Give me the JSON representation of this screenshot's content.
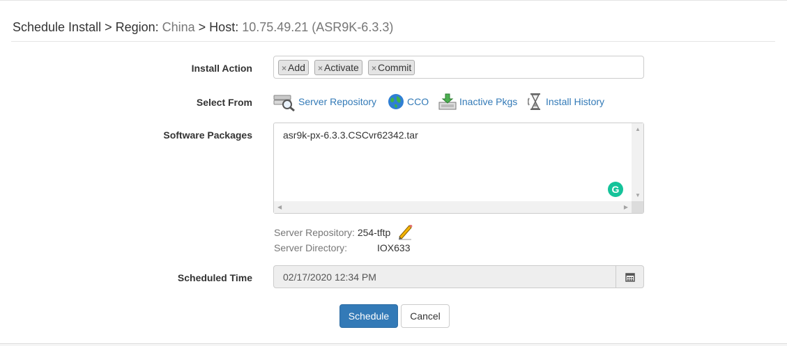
{
  "header": {
    "prefix": "Schedule Install > Region: ",
    "region": "China",
    "host_prefix": " > Host: ",
    "host": "10.75.49.21 (ASR9K-6.3.3)"
  },
  "form": {
    "install_action_label": "Install Action",
    "install_actions": [
      "Add",
      "Activate",
      "Commit"
    ],
    "tag_remove_glyph": "×",
    "select_from_label": "Select From",
    "sources": [
      {
        "label": "Server Repository",
        "icon": "server-search-icon"
      },
      {
        "label": "CCO",
        "icon": "globe-icon"
      },
      {
        "label": "Inactive Pkgs",
        "icon": "download-tray-icon"
      },
      {
        "label": "Install History",
        "icon": "hourglass-history-icon"
      }
    ],
    "software_packages_label": "Software Packages",
    "software_packages_value": "asr9k-px-6.3.3.CSCvr62342.tar",
    "grammarly_letter": "G",
    "server_repository_key": "Server Repository:",
    "server_repository_value": "254-tftp",
    "server_directory_key": "Server Directory:",
    "server_directory_value": "IOX633",
    "scheduled_time_label": "Scheduled Time",
    "scheduled_time_value": "02/17/2020 12:34 PM"
  },
  "buttons": {
    "schedule": "Schedule",
    "cancel": "Cancel"
  },
  "colors": {
    "link": "#337ab7",
    "primary": "#337ab7",
    "grammarly": "#15c39a"
  }
}
